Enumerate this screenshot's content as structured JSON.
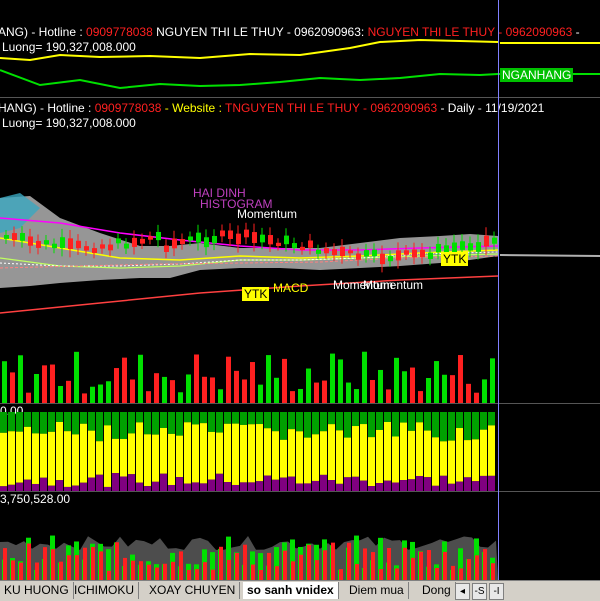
{
  "top_pane": {
    "hdr_prefix": "ANG) - Hotline : ",
    "hotline": "0909778038",
    "name1": " NGUYEN THI LE THUY - 0962090963: ",
    "name2": " NGUYEN THI LE THUY - 0962090963 ",
    "hdr_end": "- ",
    "luong": "Luong= 190,327,008.000",
    "badge": "NGANHANG"
  },
  "main_pane": {
    "hdr_prefix": "HANG) - Hotline : ",
    "hotline": "0909778038",
    "website": " - Website : ",
    "name": " TNGUYEN THI LE THUY - 0962090963",
    "period": " - Daily  - 11/19/2021",
    "luong": "Luong= 190,327,008.000",
    "ann_haidinh": "HAI DINH",
    "ann_histogram": "HISTOGRAM",
    "ann_momentum1": "Momentum",
    "ann_ytk1": "YTK",
    "ann_ytk2": "YTK",
    "ann_macd": "MACD",
    "ann_momentum2": "Momentum",
    "ann_momentum3": "Momentum"
  },
  "pane3": {
    "label": "0.00"
  },
  "pane4": {
    "label": "3,750,528.00"
  },
  "tabs": [
    {
      "label": "KU HUONG"
    },
    {
      "label": "ICHIMOKU"
    },
    {
      "label": "XOAY CHUYEN"
    },
    {
      "label": "so sanh vnidex"
    },
    {
      "label": "Diem mua"
    },
    {
      "label": "Dong"
    }
  ],
  "nav": {
    "prev": "-S",
    "next": "-I",
    "end": "◂"
  },
  "colors": {
    "bull": "#00e000",
    "bear": "#ff2020",
    "yellow": "#ffff00",
    "purple": "#800080",
    "green": "#00a000",
    "cloud": "#b0b0b0"
  }
}
